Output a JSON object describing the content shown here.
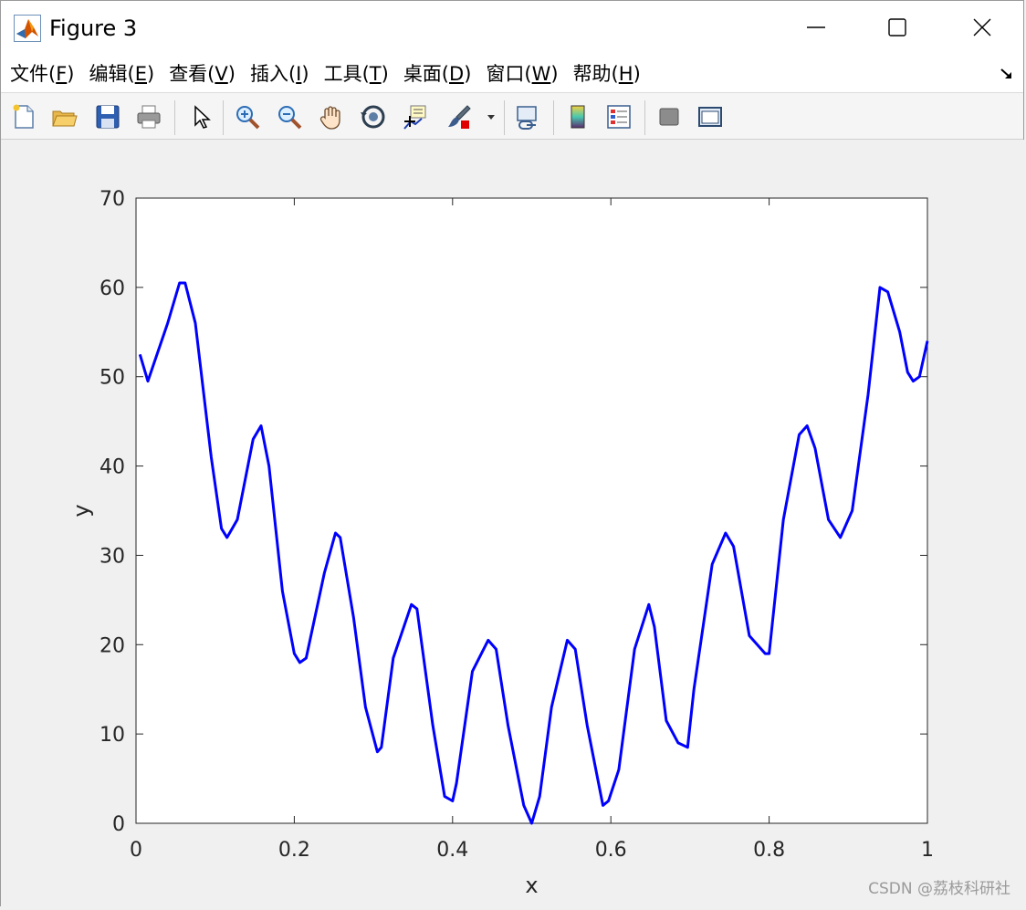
{
  "window": {
    "title": "Figure 3"
  },
  "menu": [
    {
      "label": "文件(",
      "key": "F",
      "end": ")"
    },
    {
      "label": "编辑(",
      "key": "E",
      "end": ")"
    },
    {
      "label": "查看(",
      "key": "V",
      "end": ")"
    },
    {
      "label": "插入(",
      "key": "I",
      "end": ")"
    },
    {
      "label": "工具(",
      "key": "T",
      "end": ")"
    },
    {
      "label": "桌面(",
      "key": "D",
      "end": ")"
    },
    {
      "label": "窗口(",
      "key": "W",
      "end": ")"
    },
    {
      "label": "帮助(",
      "key": "H",
      "end": ")"
    }
  ],
  "watermark": "CSDN @荔枝科研社",
  "chart_data": {
    "type": "line",
    "title": "",
    "xlabel": "x",
    "ylabel": "y",
    "xlim": [
      0,
      1
    ],
    "ylim": [
      0,
      70
    ],
    "xticks": [
      0,
      0.2,
      0.4,
      0.6,
      0.8,
      1
    ],
    "xtick_labels": [
      "0",
      "0.2",
      "0.4",
      "0.6",
      "0.8",
      "1"
    ],
    "yticks": [
      0,
      10,
      20,
      30,
      40,
      50,
      60,
      70
    ],
    "ytick_labels": [
      "0",
      "10",
      "20",
      "30",
      "40",
      "50",
      "60",
      "70"
    ],
    "grid": false,
    "line_color": "#0000ff",
    "series": [
      {
        "x": [
          0.005,
          0.015,
          0.04,
          0.055,
          0.062,
          0.075,
          0.095,
          0.108,
          0.115,
          0.128,
          0.148,
          0.158,
          0.168,
          0.185,
          0.2,
          0.207,
          0.215,
          0.238,
          0.252,
          0.258,
          0.275,
          0.29,
          0.305,
          0.31,
          0.325,
          0.348,
          0.355,
          0.375,
          0.39,
          0.4,
          0.405,
          0.425,
          0.445,
          0.455,
          0.47,
          0.49,
          0.5,
          0.51,
          0.525,
          0.545,
          0.555,
          0.57,
          0.59,
          0.597,
          0.61,
          0.63,
          0.648,
          0.655,
          0.67,
          0.685,
          0.697,
          0.705,
          0.728,
          0.745,
          0.755,
          0.775,
          0.795,
          0.8,
          0.818,
          0.838,
          0.848,
          0.858,
          0.875,
          0.89,
          0.905,
          0.925,
          0.94,
          0.95,
          0.965,
          0.975,
          0.982,
          0.99,
          1.0
        ],
        "y": [
          52.5,
          49.5,
          56,
          60.5,
          60.5,
          56,
          41,
          33,
          32,
          34,
          43,
          44.5,
          40,
          26,
          19,
          18,
          18.5,
          28,
          32.5,
          32,
          23,
          13,
          8,
          8.5,
          18.5,
          24.5,
          24,
          11,
          3,
          2.5,
          4.5,
          17,
          20.5,
          19.5,
          11,
          2,
          0,
          3,
          13,
          20.5,
          19.5,
          11,
          2,
          2.5,
          6,
          19.5,
          24.5,
          22,
          11.5,
          9,
          8.5,
          15,
          29,
          32.5,
          31,
          21,
          19,
          19,
          34,
          43.5,
          44.5,
          42,
          34,
          32,
          35,
          48,
          60,
          59.5,
          55,
          50.5,
          49.5,
          50,
          54
        ]
      }
    ]
  }
}
